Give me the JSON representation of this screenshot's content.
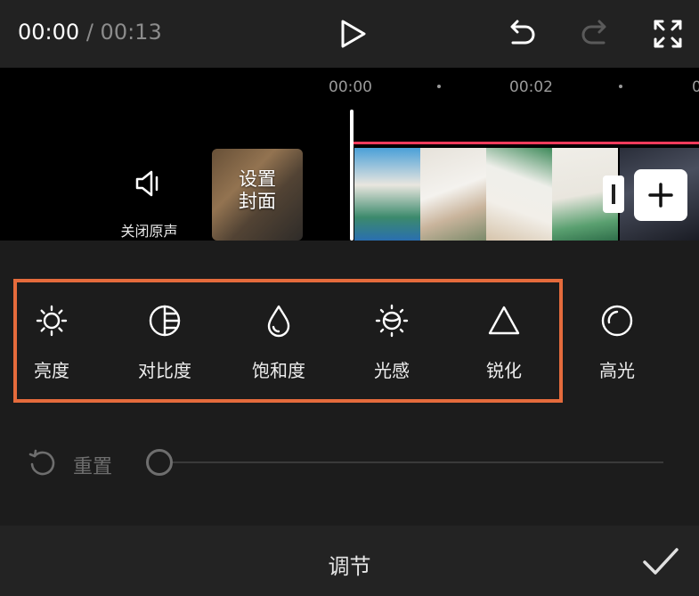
{
  "player": {
    "current_time": "00:00",
    "separator": "/",
    "duration": "00:13"
  },
  "timeline": {
    "ticks": [
      "00:00",
      "00:02",
      "0"
    ],
    "mute_label": "关闭原声",
    "cover_label": "设置\n封面"
  },
  "tools": [
    {
      "label": "亮度",
      "icon": "brightness-icon"
    },
    {
      "label": "对比度",
      "icon": "contrast-icon"
    },
    {
      "label": "饱和度",
      "icon": "saturation-icon"
    },
    {
      "label": "光感",
      "icon": "exposure-icon"
    },
    {
      "label": "锐化",
      "icon": "sharpen-icon"
    },
    {
      "label": "高光",
      "icon": "highlight-icon"
    }
  ],
  "adjust": {
    "reset_label": "重置",
    "slider_value": 0
  },
  "bottom": {
    "title": "调节"
  },
  "colors": {
    "highlight_frame": "#e56b3c",
    "timeline_marker": "#ff3b5c"
  }
}
